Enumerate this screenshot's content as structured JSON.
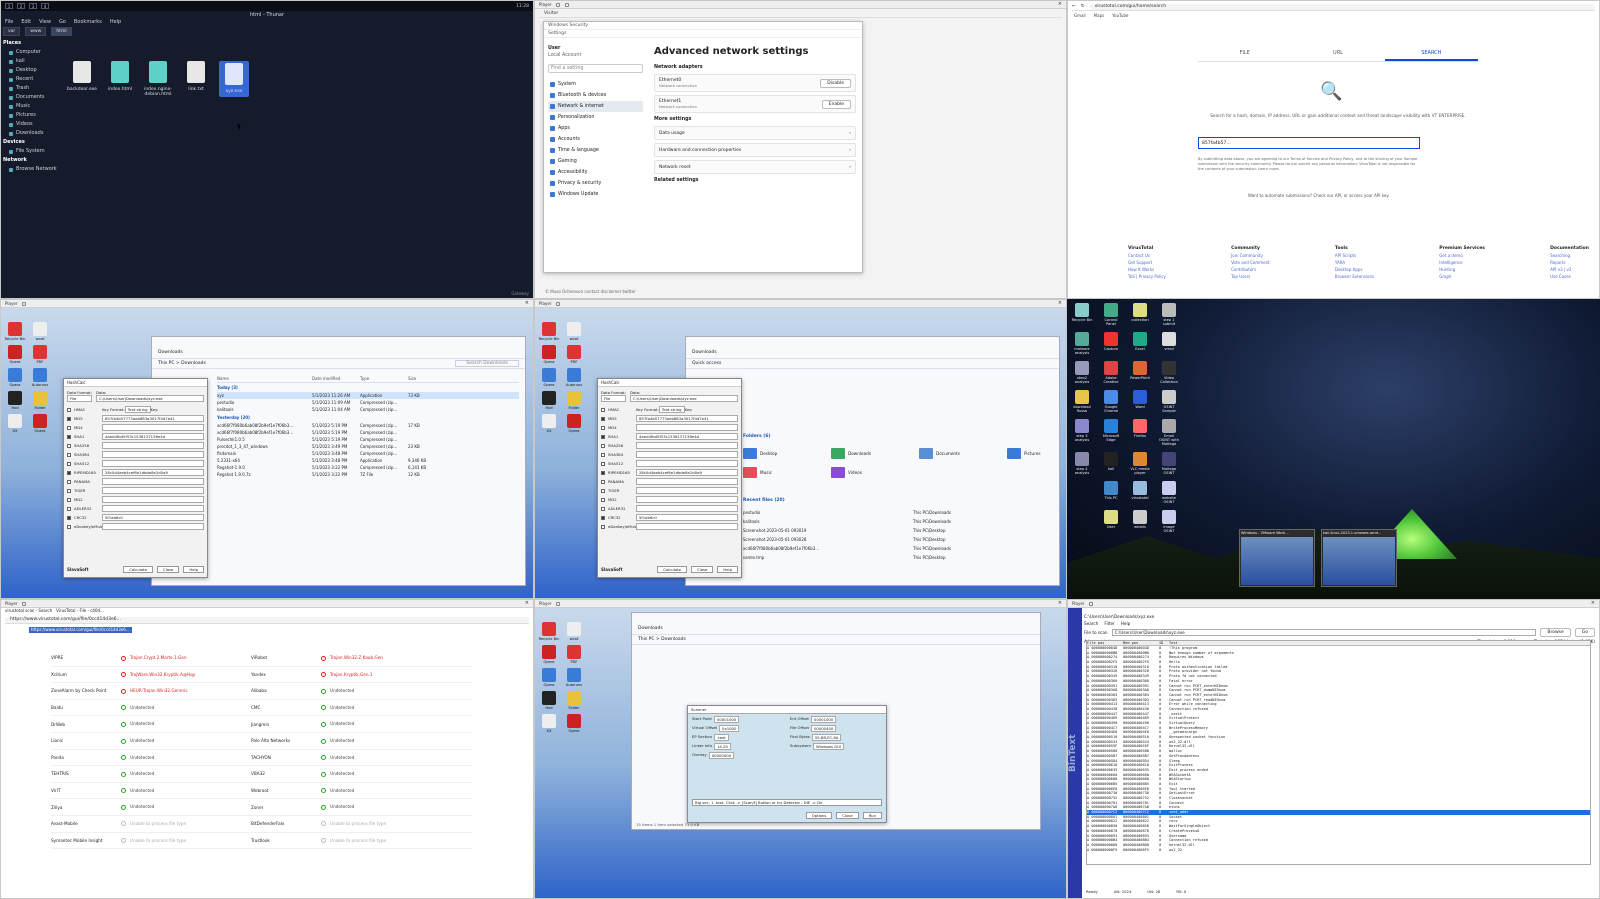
{
  "vm_bar": {
    "label": "Player"
  },
  "p1": {
    "title": "html - Thunar",
    "clock": "11:28",
    "menu": [
      "File",
      "Edit",
      "View",
      "Go",
      "Bookmarks",
      "Help"
    ],
    "path": [
      "var",
      "www",
      "html"
    ],
    "side_places_heading": "Places",
    "places": [
      "Computer",
      "kali",
      "Desktop",
      "Recent",
      "Trash",
      "Documents",
      "Music",
      "Pictures",
      "Videos",
      "Downloads"
    ],
    "side_devices_heading": "Devices",
    "devices": [
      "File System"
    ],
    "side_network_heading": "Network",
    "network": [
      "Browse Network"
    ],
    "files": [
      "backdoor.exe",
      "index.html",
      "index.nginx-debian.html",
      "link.txt",
      "xyz.exe"
    ],
    "status": "Gateway"
  },
  "p2": {
    "browser_tab": "Visitor",
    "settings_window": "Windows Security",
    "settings_app": "Settings",
    "user": "User",
    "account": "Local Account",
    "search": "Find a setting",
    "nav": [
      "System",
      "Bluetooth & devices",
      "Network & internet",
      "Personalization",
      "Apps",
      "Accounts",
      "Time & language",
      "Gaming",
      "Accessibility",
      "Privacy & security",
      "Windows Update"
    ],
    "heading": "Advanced network settings",
    "adapters_title": "Network adapters",
    "adapters": [
      {
        "name": "Ethernet0",
        "sub": "Network connection",
        "action": "Disable"
      },
      {
        "name": "Ethernet1",
        "sub": "Network connection",
        "action": "Enable"
      }
    ],
    "more_title": "More settings",
    "more": [
      "Data usage",
      "Hardware and connection properties",
      "Network reset"
    ],
    "related": "Related settings",
    "footer": "© Muso Ochienson   contact   disclaimer   twitter"
  },
  "p3": {
    "url": "virustotal.com/gui/home/search",
    "bookmarks": [
      "Gmail",
      "Maps",
      "YouTube"
    ],
    "tabs": [
      "FILE",
      "URL",
      "SEARCH"
    ],
    "desc": "Search for a hash, domain, IP address, URL or gain additional context and threat landscape visibility with VT ENTERPRISE.",
    "input": "857fa4b57...",
    "legal": "By submitting data above, you are agreeing to our Terms of Service and Privacy Policy, and to the sharing of your Sample submission with the security community. Please do not submit any personal information; VirusTotal is not responsible for the contents of your submission. Learn more.",
    "automate": "Want to automate submissions? Check our API, or access your API key.",
    "footer": [
      {
        "head": "VirusTotal",
        "items": [
          "Contact Us",
          "Get Support",
          "How It Works",
          "ToS | Privacy Policy"
        ]
      },
      {
        "head": "Community",
        "items": [
          "Join Community",
          "Vote and Comment",
          "Contributors",
          "Top Users"
        ]
      },
      {
        "head": "Tools",
        "items": [
          "API Scripts",
          "YARA",
          "Desktop Apps",
          "Browser Extensions"
        ]
      },
      {
        "head": "Premium Services",
        "items": [
          "Get a demo",
          "Intelligence",
          "Hunting",
          "Graph"
        ]
      },
      {
        "head": "Documentation",
        "items": [
          "Searching",
          "Reports",
          "API v3 | v2",
          "Use Cases"
        ]
      }
    ]
  },
  "p4": {
    "desktop_icons": [
      "Recycle Bin",
      "word",
      "Opera",
      "PDF",
      "Opera",
      "Autoruns",
      "Hxd",
      "Folder",
      "XX",
      "Opera"
    ],
    "explorer_title": "Downloads",
    "path": "This PC > Downloads",
    "search": "Search Downloads",
    "cols": [
      "Name",
      "Date modified",
      "Type",
      "Size"
    ],
    "groups": [
      "Today (3)",
      "Yesterday (20)"
    ],
    "rows": [
      {
        "n": "xyz",
        "d": "5/1/2023 11:26 AM",
        "t": "Application",
        "s": "73 KB",
        "sel": true
      },
      {
        "n": "pestudio",
        "d": "5/1/2023 11:09 AM",
        "t": "Compressed (zip...",
        "s": ""
      },
      {
        "n": "kalitools",
        "d": "5/1/2023 11:04 AM",
        "t": "Compressed (zip...",
        "s": ""
      },
      {
        "n": "xcd66f7f080b6ab08f2b9ef1e7f06b3...",
        "d": "5/1/2023 5:19 PM",
        "t": "Compressed (zip...",
        "s": "17 KB"
      },
      {
        "n": "xcd66f7f080b6ab08f2b9ef1e7f06b3...",
        "d": "5/1/2023 5:19 PM",
        "t": "Compressed (zip...",
        "s": ""
      },
      {
        "n": "Pulsechk1.0.5",
        "d": "5/1/2023 5:19 PM",
        "t": "Compressed (zip...",
        "s": ""
      },
      {
        "n": "procdot_1_3_47_windows",
        "d": "5/1/2023 3:49 PM",
        "t": "Compressed (zip...",
        "s": "23 KB"
      },
      {
        "n": "flsdsmain",
        "d": "5/1/2023 3:48 PM",
        "t": "Compressed (zip...",
        "s": ""
      },
      {
        "n": "5.2331-x64",
        "d": "5/1/2023 3:48 PM",
        "t": "Application",
        "s": "9,346 KB"
      },
      {
        "n": "Regshot-1.9.0",
        "d": "5/1/2023 3:22 PM",
        "t": "Compressed (zip...",
        "s": "6,143 KB"
      },
      {
        "n": "Regshot 1.9.0.7z",
        "d": "5/1/2023 3:22 PM",
        "t": "7Z File",
        "s": "12 KB"
      }
    ],
    "hashcalc": {
      "title": "HashCalc",
      "data_format_label": "Data Format:",
      "data_format": "File",
      "data_label": "Data:",
      "data": "C:\\Users\\User\\Downloads\\xyz.exe",
      "hmac": "HMAC",
      "key_format": "Key Format:",
      "key_format_value": "Text string",
      "key": "Key:",
      "algos": [
        {
          "n": "MD5",
          "v": "857fa4b57773aeb883a3017f4d7e41",
          "on": true
        },
        {
          "n": "MD4",
          "v": "",
          "on": false
        },
        {
          "n": "SHA1",
          "v": "4aed4fbd5f53c1536137138e4d",
          "on": true
        },
        {
          "n": "SHA256",
          "v": "",
          "on": false
        },
        {
          "n": "SHA384",
          "v": "",
          "on": false
        },
        {
          "n": "SHA512",
          "v": "",
          "on": false
        },
        {
          "n": "RIPEMD160",
          "v": "28c0d4aeb4cef6e1dbde8e2d0a9",
          "on": true
        },
        {
          "n": "PANAMA",
          "v": "",
          "on": false
        },
        {
          "n": "TIGER",
          "v": "",
          "on": false
        },
        {
          "n": "MD2",
          "v": "",
          "on": false
        },
        {
          "n": "ADLER32",
          "v": "",
          "on": false
        },
        {
          "n": "CRC32",
          "v": "5f1ab6c0",
          "on": true
        },
        {
          "n": "eDonkey/eMule",
          "v": "",
          "on": false
        }
      ],
      "brand": "SlavaSoft",
      "buttons": [
        "Calculate",
        "Close",
        "Help"
      ]
    }
  },
  "p5": {
    "quick_title": "Quick access",
    "folders_title": "Folders (6)",
    "folders": [
      "Desktop",
      "Downloads",
      "Documents",
      "Pictures",
      "Music",
      "Videos"
    ],
    "recent_title": "Recent files (20)",
    "recent": [
      {
        "n": "pestudio",
        "l": "This PC\\Downloads"
      },
      {
        "n": "kalitools",
        "l": "This PC\\Downloads"
      },
      {
        "n": "Screenshot 2023-05-01 093019",
        "l": "This PC\\Desktop"
      },
      {
        "n": "Screenshot 2023-05-01 093028",
        "l": "This PC\\Desktop"
      },
      {
        "n": "xcd66f7f080b6ab08f2b9ef1e7f06b3...",
        "l": "This PC\\Downloads"
      },
      {
        "n": "samle.tmp",
        "l": "This PC\\Desktop"
      }
    ]
  },
  "p6": {
    "icons": [
      "Recycle Bin",
      "Control Panel",
      "collection",
      "step 1 submit",
      "malware analysis",
      "Capture",
      "Excel",
      "vmrd",
      "step2 analysis",
      "Adobe Creative",
      "PowerPoint",
      "Video Collection",
      "download flusso",
      "Google Chrome",
      "Word",
      "OSINT Sample",
      "step 3 analysis",
      "Microsoft Edge",
      "Firefox",
      "Email OSINT with Maltego",
      "step 4 analysis",
      "kali",
      "VLC media player",
      "Maltego OSINT",
      "",
      "This PC",
      "virustotal",
      "website OSINT",
      "",
      "User",
      "whatis",
      "image OSINT",
      ""
    ],
    "thumbs": [
      "Windows - VMware Work...",
      "kali-linux-2023.1-vmware-amd..."
    ]
  },
  "p7": {
    "tabs": [
      "virustotal scan - Search",
      "VirusTotal - File - c40d..."
    ],
    "url": "https://www.virustotal.com/gui/file/0ccd14d3e6...",
    "rows": [
      {
        "a": "VIPRE",
        "ar": "Trojan.Crypt.2.Marte.1.Gen",
        "as": "bad",
        "b": "ViRobot",
        "br": "Trojan.Win32.Z.Kaub.Gen",
        "bs": "bad"
      },
      {
        "a": "Xcitium",
        "ar": "TrojWare.Win32.Kryptik.A@Hqy",
        "as": "bad",
        "b": "Yandex",
        "br": "Trojan.Kryptik.Gen.1",
        "bs": "bad"
      },
      {
        "a": "ZoneAlarm by Check Point",
        "ar": "HEUR:Trojan.Win32.Generic",
        "as": "bad",
        "b": "Alibaba",
        "br": "Undetected",
        "bs": "ok"
      },
      {
        "a": "Baidu",
        "ar": "Undetected",
        "as": "ok",
        "b": "CMC",
        "br": "Undetected",
        "bs": "ok"
      },
      {
        "a": "DrWeb",
        "ar": "Undetected",
        "as": "ok",
        "b": "Jiangmin",
        "br": "Undetected",
        "bs": "ok"
      },
      {
        "a": "Lionic",
        "ar": "Undetected",
        "as": "ok",
        "b": "Palo Alto Networks",
        "br": "Undetected",
        "bs": "ok"
      },
      {
        "a": "Panda",
        "ar": "Undetected",
        "as": "ok",
        "b": "TACHYON",
        "br": "Undetected",
        "bs": "ok"
      },
      {
        "a": "TEHTRIS",
        "ar": "Undetected",
        "as": "ok",
        "b": "VBA32",
        "br": "Undetected",
        "bs": "ok"
      },
      {
        "a": "VirIT",
        "ar": "Undetected",
        "as": "ok",
        "b": "Webroot",
        "br": "Undetected",
        "bs": "ok"
      },
      {
        "a": "Zillya",
        "ar": "Undetected",
        "as": "ok",
        "b": "Zoner",
        "br": "Undetected",
        "bs": "ok"
      },
      {
        "a": "Avast-Mobile",
        "ar": "Unable to process file type",
        "as": "na",
        "b": "BitDefenderFalx",
        "br": "Unable to process file type",
        "bs": "na"
      },
      {
        "a": "Symantec Mobile Insight",
        "ar": "Unable to process file type",
        "as": "na",
        "b": "Trustlook",
        "br": "Unable to process file type",
        "bs": "na"
      }
    ]
  },
  "p8": {
    "explorer_title": "Downloads",
    "path": "This PC > Downloads",
    "scanner_title": "Scanner",
    "fields": [
      "Start Point",
      "Ent Offset",
      "Virtual Offset",
      "File Offset",
      "EP Section",
      "First Bytes",
      "Linker Info",
      "Subsystem",
      "Overlay"
    ],
    "values": [
      "00001000",
      "00001000",
      "0x1000",
      "00000400",
      ".text",
      "55,8B,EC,6A",
      "14.29",
      "Windows GUI",
      "00000000"
    ],
    "hint_line": "Big sec. 1 .text, Click -> [Scan/t] Button or try Detector : DIE -> Dir",
    "buttons": [
      "Options",
      "Close",
      "Run"
    ],
    "status": "15 items   1 item selected  73.0 KB"
  },
  "p9": {
    "brand": "BinText",
    "title": "C:\\Users\\User\\Downloads\\xyz.exe",
    "tabs": [
      "Search",
      "Filter",
      "Help"
    ],
    "file_label": "File to scan",
    "file": "C:\\Users\\User\\Downloads\\xyz.exe",
    "browse": "Browse",
    "go": "Go",
    "advanced": "Advanced view",
    "time": "Time taken: 0.016 secs",
    "text_size": "Text size: 1874 bytes (1.83K)",
    "cols": [
      "File pos",
      "Mem pos",
      "ID",
      "Text"
    ],
    "rows": [
      [
        "A 00000000004D",
        "00000040004D",
        "0",
        "!This program"
      ],
      [
        "A 0000000000B8",
        "0000004000B8",
        "0",
        "Not enough number of arguments"
      ],
      [
        "A 000000000274",
        "000000400274",
        "0",
        "Requires Windows"
      ],
      [
        "A 0000000002F5",
        "0000004002F5",
        "0",
        "Hello"
      ],
      [
        "A 000000000310",
        "000000400310",
        "0",
        "Proto authentication failed"
      ],
      [
        "A 000000000328",
        "000000400328",
        "0",
        "Proto provider not found"
      ],
      [
        "A 000000000349",
        "000000400349",
        "0",
        "Proto fd not connected"
      ],
      [
        "A 000000000360",
        "000000400360",
        "0",
        "Fatal error"
      ],
      [
        "A 000000000391",
        "000000400391",
        "0",
        "Cannot run PCRT_enterNIDnum"
      ],
      [
        "A 0000000003A8",
        "0000004003A8",
        "0",
        "Cannot run PCRT_dumpNIDnum"
      ],
      [
        "A 000000000383",
        "000000400383",
        "0",
        "Cannot run PCRT_enterNIDnum"
      ],
      [
        "A 0000000003D3",
        "0000004003D3",
        "0",
        "Cannot run PCRT_readNIDnum"
      ],
      [
        "A 000000000413",
        "000000400413",
        "0",
        "Error while connecting"
      ],
      [
        "A 000000000430",
        "000000400430",
        "0",
        "Connection refused"
      ],
      [
        "A 000000000447",
        "000000400447",
        "0",
        "_cexit"
      ],
      [
        "A 000000000469",
        "000000400469",
        "0",
        "VirtualProtect"
      ],
      [
        "A 000000000490",
        "000000400490",
        "0",
        "VirtualQuery"
      ],
      [
        "A 0000000004C7",
        "0000004004C7",
        "0",
        "WriteProcessMemory"
      ],
      [
        "A 0000000004E0",
        "0000004004E0",
        "0",
        "__getmainargs"
      ],
      [
        "A 000000000510",
        "000000400510",
        "0",
        "Unexpected socket function"
      ],
      [
        "A 000000000534",
        "000000400534",
        "0",
        "ws2_32.dll"
      ],
      [
        "A 00000000055F",
        "00000040055F",
        "0",
        "Kernel32.dll"
      ],
      [
        "A 000000000580",
        "000000400580",
        "0",
        "malloc"
      ],
      [
        "A 0000000005B7",
        "0000004005B7",
        "0",
        "GetProcAddress"
      ],
      [
        "A 0000000005D4",
        "0000004005D4",
        "0",
        "Sleep"
      ],
      [
        "A 000000000618",
        "000000400618",
        "0",
        "ExitProcess"
      ],
      [
        "A 000000000635",
        "000000400635",
        "0",
        "Exit process ended"
      ],
      [
        "A 000000000660",
        "000000400660",
        "0",
        "WSASocketA"
      ],
      [
        "A 000000000688",
        "000000400688",
        "0",
        "WSAStartup"
      ],
      [
        "A 0000000006B5",
        "0000004006B5",
        "0",
        "Exit"
      ],
      [
        "A 0000000006E0",
        "0000004006E0",
        "0",
        "Tool started"
      ],
      [
        "A 000000000730",
        "000000400730",
        "0",
        "GetLastError"
      ],
      [
        "A 000000000752",
        "000000400752",
        "0",
        "Closesocket"
      ],
      [
        "A 000000000781",
        "000000400781",
        "0",
        "Connect"
      ],
      [
        "A 0000000007A0",
        "0000004007A0",
        "0",
        "htons"
      ],
      [
        "A 0000000007C2",
        "0000004007C2",
        "0",
        "inet_addr"
      ],
      [
        "A 000000000801",
        "000000400801",
        "0",
        "Socket"
      ],
      [
        "A 000000000822",
        "000000400822",
        "0",
        "recv"
      ],
      [
        "A 000000000850",
        "000000400850",
        "0",
        "WaitForSingleObject"
      ],
      [
        "A 000000000870",
        "000000400870",
        "0",
        "CreateProcessA"
      ],
      [
        "A 000000000893",
        "000000400893",
        "0",
        "Username"
      ],
      [
        "A 0000000008B4",
        "0000004008B4",
        "0",
        "Connection refused"
      ],
      [
        "A 0000000008D0",
        "0000004008D0",
        "0",
        "kernel32.dll"
      ],
      [
        "A 0000000008F5",
        "0000004008F5",
        "0",
        "ws2_32"
      ]
    ],
    "selected": 35,
    "status": [
      "Ready",
      "AN: 1024",
      "UN: 28",
      "RS: 0"
    ]
  }
}
